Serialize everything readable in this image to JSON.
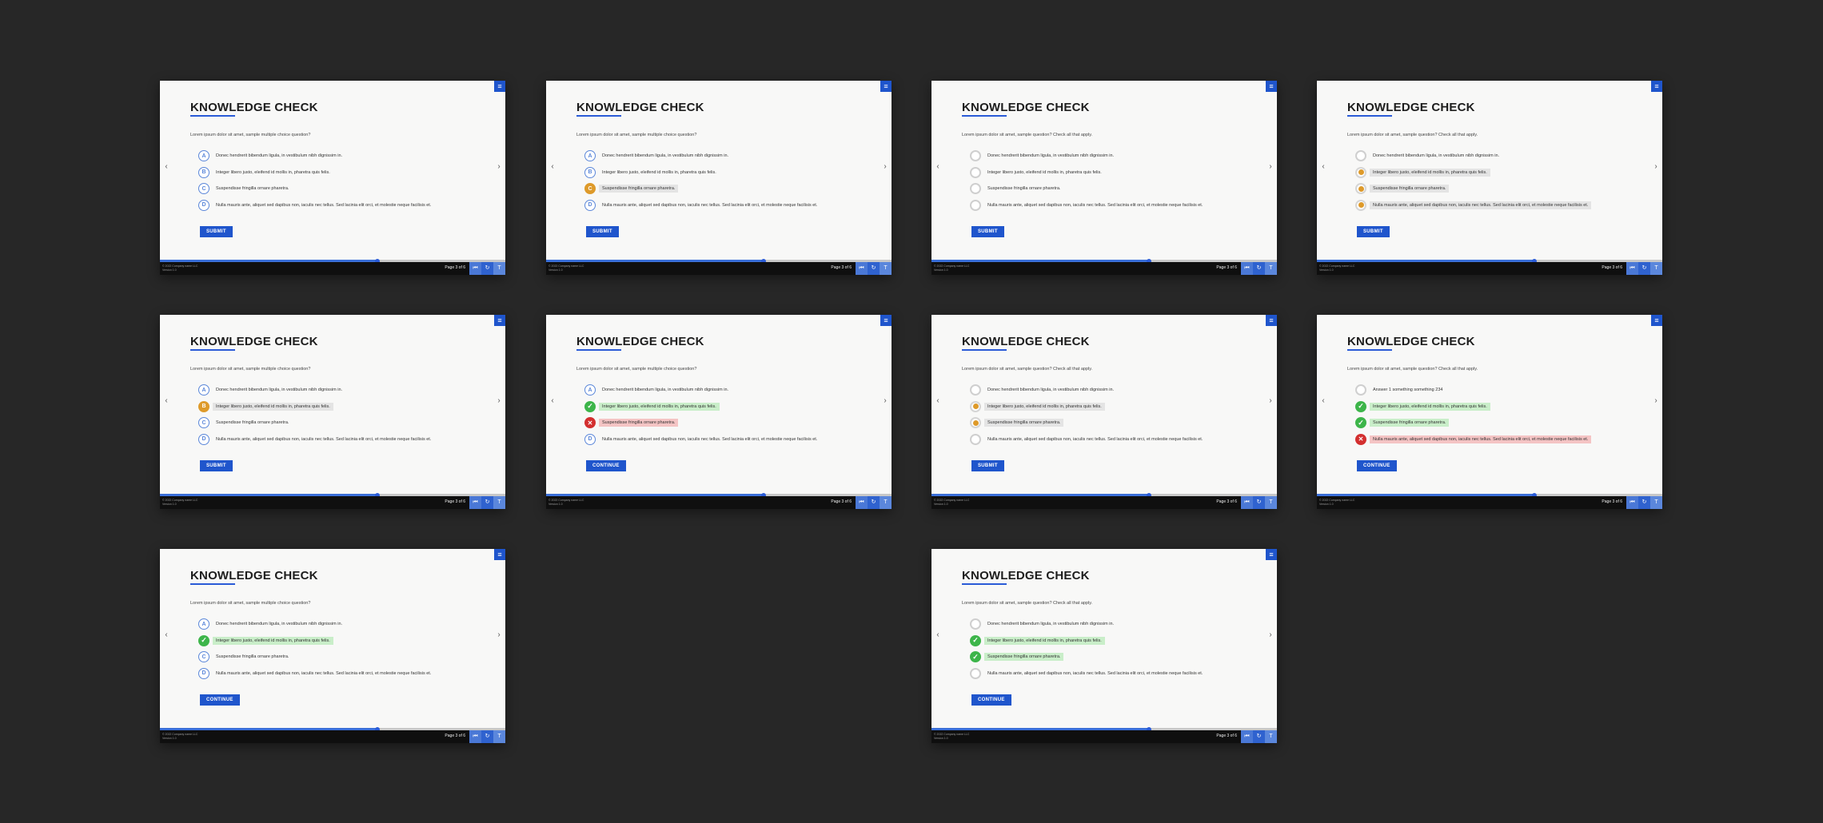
{
  "common": {
    "title": "KNOWLEDGE CHECK",
    "menu_icon": "≡",
    "nav_left": "‹",
    "nav_right": "›",
    "page_label": "Page 3 of 6",
    "footer_copy_1": "© 2022 Company name LLC",
    "footer_copy_2": "Version 1.0",
    "questions": {
      "mc": "Lorem ipsum dolor sit amet, sample multiple choice question?",
      "ms": "Lorem ipsum dolor sit amet, sample question? Check all that apply."
    },
    "options": [
      "Donec hendrerit bibendum ligula, in vestibulum nibh dignissim in.",
      "Integer libero justo, eleifend id mollis in, pharetra quis felis.",
      "Suspendisse fringilla ornare pharetra.",
      "Nulla mauris ante, aliquet sed dapibus non, iaculis nec tellus. Sed lacinia elit orci, et molestie neque facilisis et."
    ],
    "alt_option_a": "Answer 1 something something 234",
    "letters": [
      "A",
      "B",
      "C",
      "D"
    ],
    "btn_submit": "SUBMIT",
    "btn_continue": "CONTINUE",
    "icons": {
      "ok": "✓",
      "bad": "✕",
      "prev": "⏮",
      "replay": "↻",
      "info": "T"
    },
    "colors": {
      "accent": "#1f55cc",
      "selected": "#de9a2a",
      "correct": "#3db54a",
      "incorrect": "#d32f2f"
    }
  },
  "slides": [
    {
      "slide": 1,
      "question_type": "mc",
      "button": "SUBMIT",
      "progress": 0.63,
      "options": [
        "letter",
        "letter",
        "letter",
        "letter"
      ]
    },
    {
      "slide": 2,
      "question_type": "mc",
      "button": "SUBMIT",
      "progress": 0.63,
      "options": [
        "letter",
        "letter",
        "selected",
        "letter"
      ]
    },
    {
      "slide": 3,
      "question_type": "ms",
      "button": "SUBMIT",
      "progress": 0.63,
      "options": [
        "circle",
        "circle",
        "circle",
        "circle"
      ]
    },
    {
      "slide": 4,
      "question_type": "ms",
      "button": "SUBMIT",
      "progress": 0.63,
      "options": [
        "circle",
        "checked",
        "checked",
        "checked"
      ]
    },
    {
      "slide": 5,
      "question_type": "mc",
      "button": "SUBMIT",
      "progress": 0.63,
      "options": [
        "letter",
        "selected",
        "letter",
        "letter"
      ]
    },
    {
      "slide": 6,
      "question_type": "mc",
      "button": "CONTINUE",
      "progress": 0.63,
      "options": [
        "letter",
        "correct",
        "incorrect",
        "letter"
      ]
    },
    {
      "slide": 7,
      "question_type": "ms",
      "button": "SUBMIT",
      "progress": 0.63,
      "options": [
        "circle",
        "checked",
        "checked",
        "circle"
      ]
    },
    {
      "slide": 8,
      "question_type": "ms",
      "button": "CONTINUE",
      "progress": 0.63,
      "first_option": "alt",
      "options": [
        "circle",
        "correct",
        "correct",
        "incorrect"
      ]
    },
    {
      "slide": 9,
      "question_type": "mc",
      "button": "CONTINUE",
      "progress": 0.63,
      "options": [
        "letter",
        "correct",
        "letter",
        "letter"
      ]
    },
    {
      "slide": 10,
      "question_type": "ms",
      "button": "CONTINUE",
      "progress": 0.63,
      "options": [
        "circle",
        "correct",
        "correct",
        "circle"
      ]
    }
  ]
}
